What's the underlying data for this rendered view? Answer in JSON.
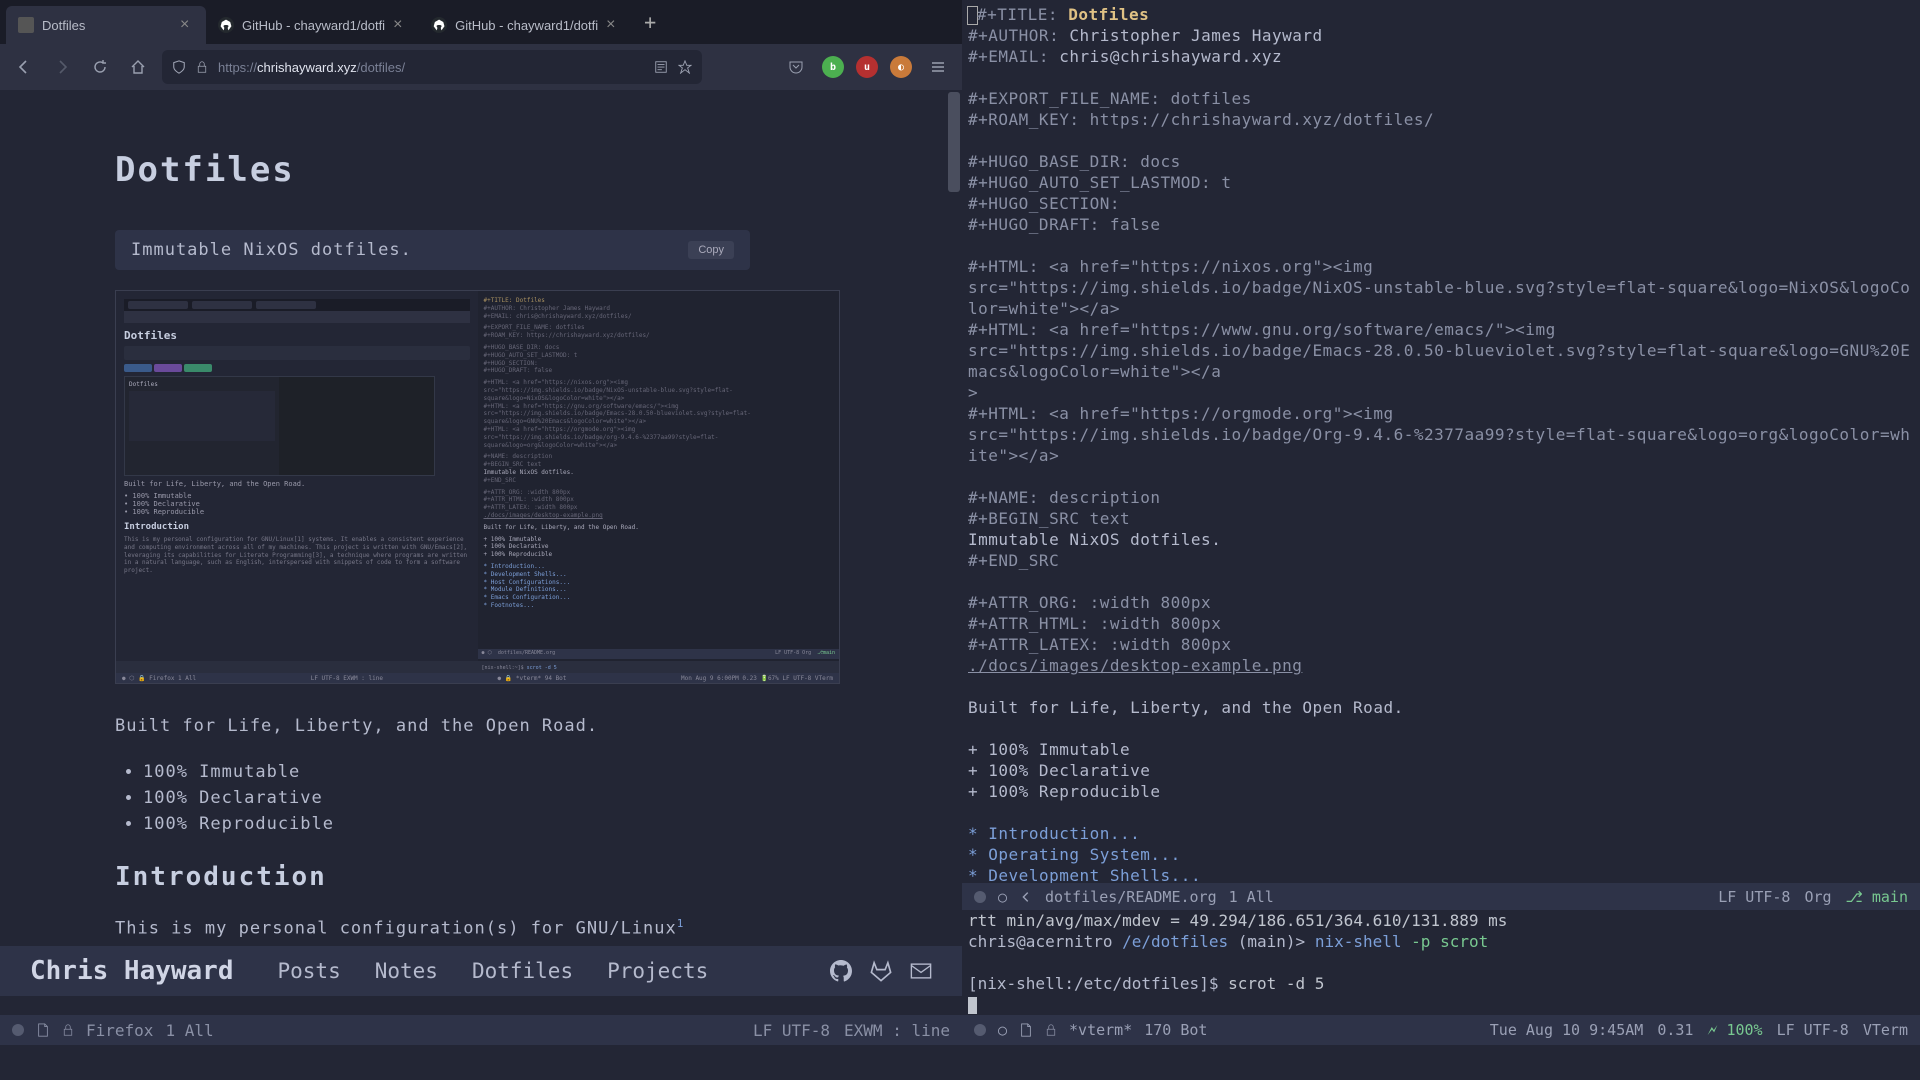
{
  "tabs": [
    {
      "title": "Dotfiles",
      "favicon": "site"
    },
    {
      "title": "GitHub - chayward1/dotfi",
      "favicon": "github"
    },
    {
      "title": "GitHub - chayward1/dotfi",
      "favicon": "github"
    }
  ],
  "url": {
    "scheme": "https://",
    "domain": "chrishayward.xyz",
    "path": "/dotfiles/"
  },
  "site": {
    "h1": "Dotfiles",
    "code": "Immutable NixOS dotfiles.",
    "copy": "Copy",
    "tagline": "Built for Life, Liberty, and the Open Road.",
    "bullets": [
      "100% Immutable",
      "100% Declarative",
      "100% Reproducible"
    ],
    "h2": "Introduction",
    "intro_l1": "This is my personal configuration(s) for GNU/Linux",
    "intro_sup": "1",
    "intro_l1b": " systems. It enables a",
    "intro_l2": "consistent experience and computing environment across all of my machines. This",
    "nav_brand": "Chris Hayward",
    "nav_links": [
      "Posts",
      "Notes",
      "Dotfiles",
      "Projects"
    ]
  },
  "modeline_left": {
    "buffer": "Firefox",
    "pos": "1 All",
    "enc": "LF UTF-8",
    "mode": "EXWM : line"
  },
  "org": {
    "title_kw": "#+TITLE:",
    "title": "Dotfiles",
    "author_kw": "#+AUTHOR:",
    "author": "Christopher James Hayward",
    "email_kw": "#+EMAIL:",
    "email": "chris@chrishayward.xyz",
    "export_kw": "#+EXPORT_FILE_NAME: dotfiles",
    "roam_kw": "#+ROAM_KEY: https://chrishayward.xyz/dotfiles/",
    "hugo_base": "#+HUGO_BASE_DIR: docs",
    "hugo_lastmod": "#+HUGO_AUTO_SET_LASTMOD: t",
    "hugo_section": "#+HUGO_SECTION:",
    "hugo_draft": "#+HUGO_DRAFT: false",
    "html1a": "#+HTML: <a href=\"https://nixos.org\"><img",
    "html1b": "src=\"https://img.shields.io/badge/NixOS-unstable-blue.svg?style=flat-square&logo=NixOS&logoColor=white\"></a>",
    "html2a": "#+HTML: <a href=\"https://www.gnu.org/software/emacs/\"><img",
    "html2b": "src=\"https://img.shields.io/badge/Emacs-28.0.50-blueviolet.svg?style=flat-square&logo=GNU%20Emacs&logoColor=white\"></a",
    "html2c": ">",
    "html3a": "#+HTML: <a href=\"https://orgmode.org\"><img",
    "html3b": "src=\"https://img.shields.io/badge/Org-9.4.6-%2377aa99?style=flat-square&logo=org&logoColor=white\"></a>",
    "name": "#+NAME: description",
    "begin": "#+BEGIN_SRC text",
    "src": "Immutable NixOS dotfiles.",
    "end": "#+END_SRC",
    "attr_org": "#+ATTR_ORG: :width 800px",
    "attr_html": "#+ATTR_HTML: :width 800px",
    "attr_latex": "#+ATTR_LATEX: :width 800px",
    "img_link": "./docs/images/desktop-example.png",
    "tagline": "Built for Life, Liberty, and the Open Road.",
    "plus1": "+ 100% Immutable",
    "plus2": "+ 100% Declarative",
    "plus3": "+ 100% Reproducible",
    "h1": "Introduction...",
    "h2": "Operating System...",
    "h3": "Development Shells...",
    "h4": "Host Configurations...",
    "h5": "Module Definitions...",
    "h6": "Emacs Configuration..."
  },
  "modeline_org": {
    "path": "dotfiles/README.org",
    "pos": "1 All",
    "enc": "LF UTF-8",
    "mode": "Org",
    "branch": "main"
  },
  "vterm": {
    "l1": "rtt min/avg/max/mdev = 49.294/186.651/364.610/131.889 ms",
    "user": "chris",
    "host": "@acernitro",
    "path": "/e/dotfiles",
    "branch": "(main)>",
    "cmd1": "nix-shell",
    "cmd1_args": "-p scrot",
    "prompt2": "[nix-shell:/etc/dotfiles]$",
    "cmd2": "scrot -d 5"
  },
  "modeline_right": {
    "buffer": "*vterm*",
    "pos": "170 Bot",
    "date": "Tue Aug 10 9:45AM",
    "load": "0.31",
    "batt": "100%",
    "enc": "LF UTF-8",
    "mode": "VTerm"
  }
}
